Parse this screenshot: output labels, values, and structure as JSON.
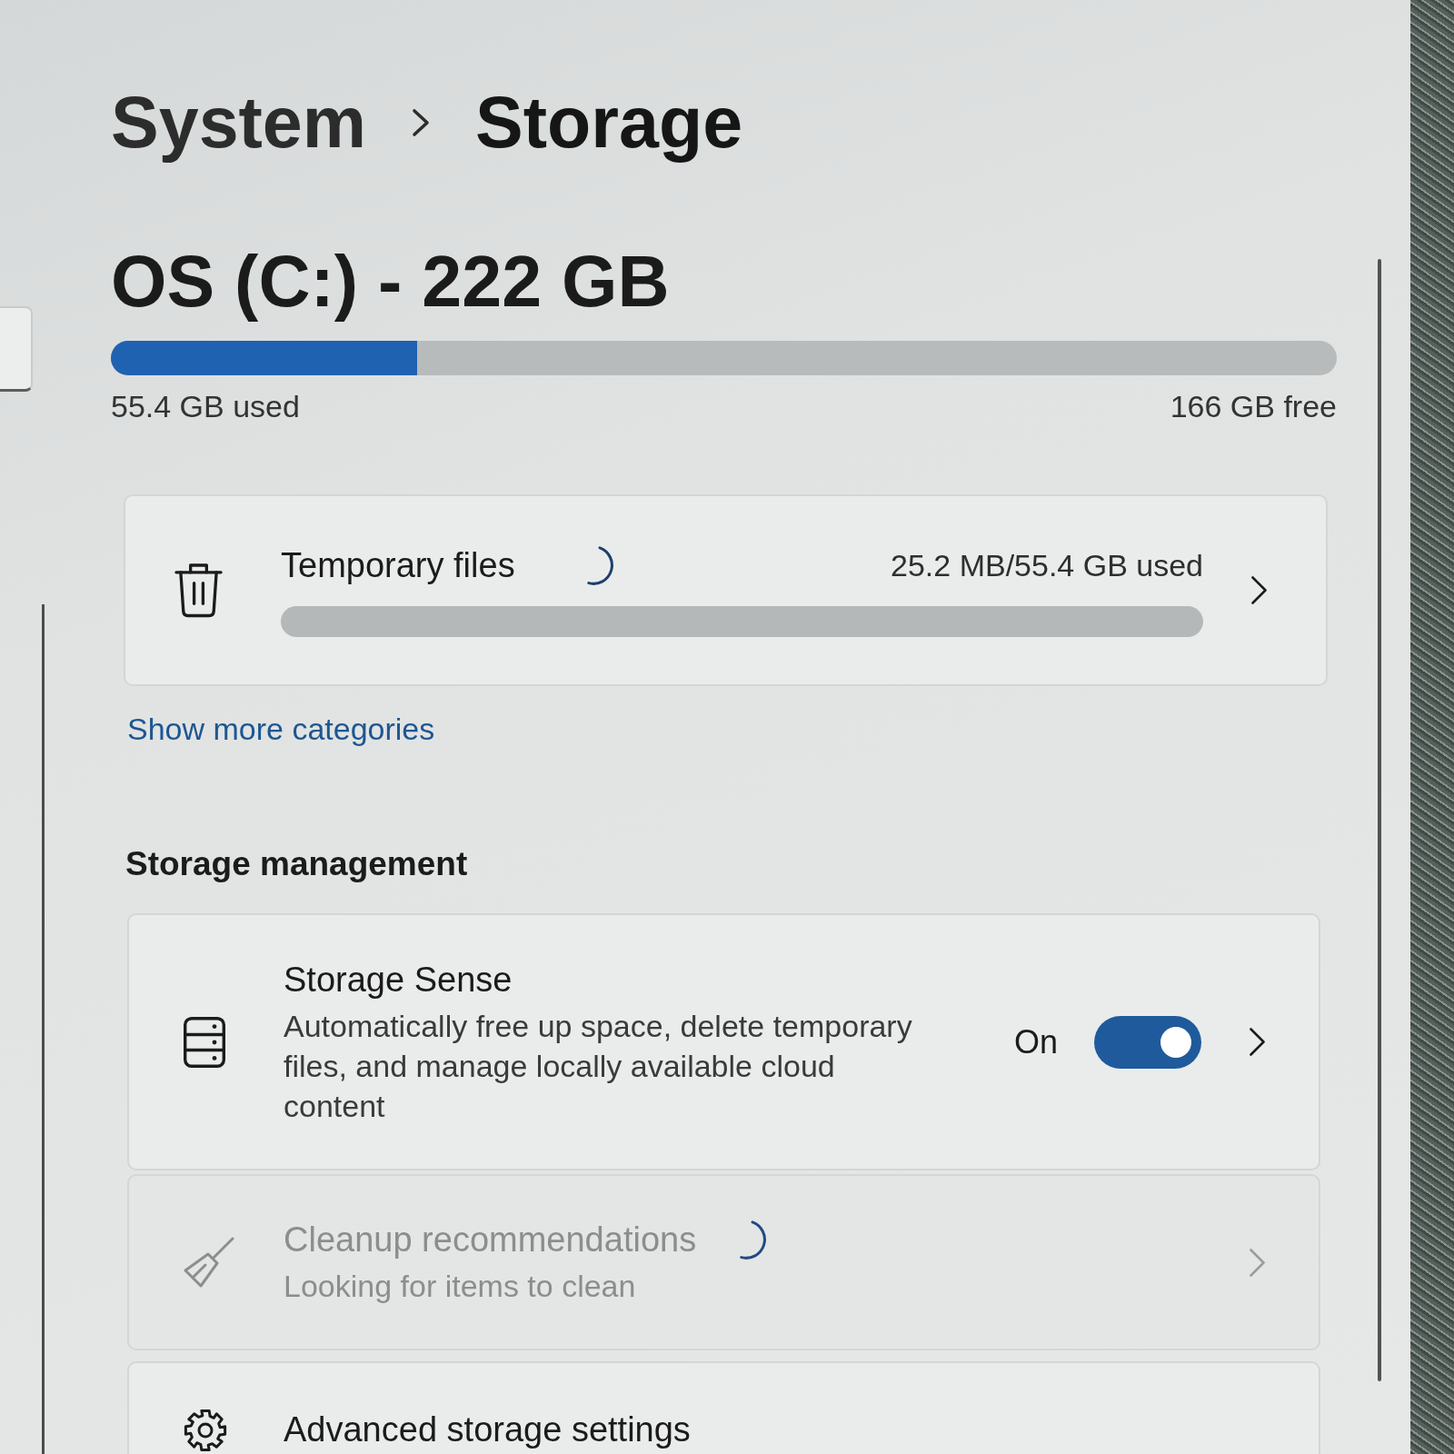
{
  "breadcrumb": [
    {
      "label": "System"
    },
    {
      "label": "Storage"
    }
  ],
  "drive": {
    "title": "OS (C:) - 222 GB",
    "level": 0.25,
    "used": "55.4 GB used",
    "free": "166 GB free"
  },
  "categories": [
    {
      "label": "Temporary files",
      "loading": true,
      "reading": "25.2 MB/55.4 GB used"
    }
  ],
  "show_more": "Show more categories",
  "storage_management": {
    "heading": "Storage management",
    "items": [
      {
        "kind": "toggle",
        "title": "Storage Sense",
        "description": "Automatically free up space, delete temporary files, and manage locally available cloud content",
        "state_label": "On",
        "on": true,
        "disabled": false
      },
      {
        "kind": "status",
        "title": "Cleanup recommendations",
        "description": "Looking for items to clean",
        "loading": true,
        "disabled": true
      },
      {
        "kind": "link",
        "title": "Advanced storage settings",
        "disabled": false
      }
    ]
  }
}
